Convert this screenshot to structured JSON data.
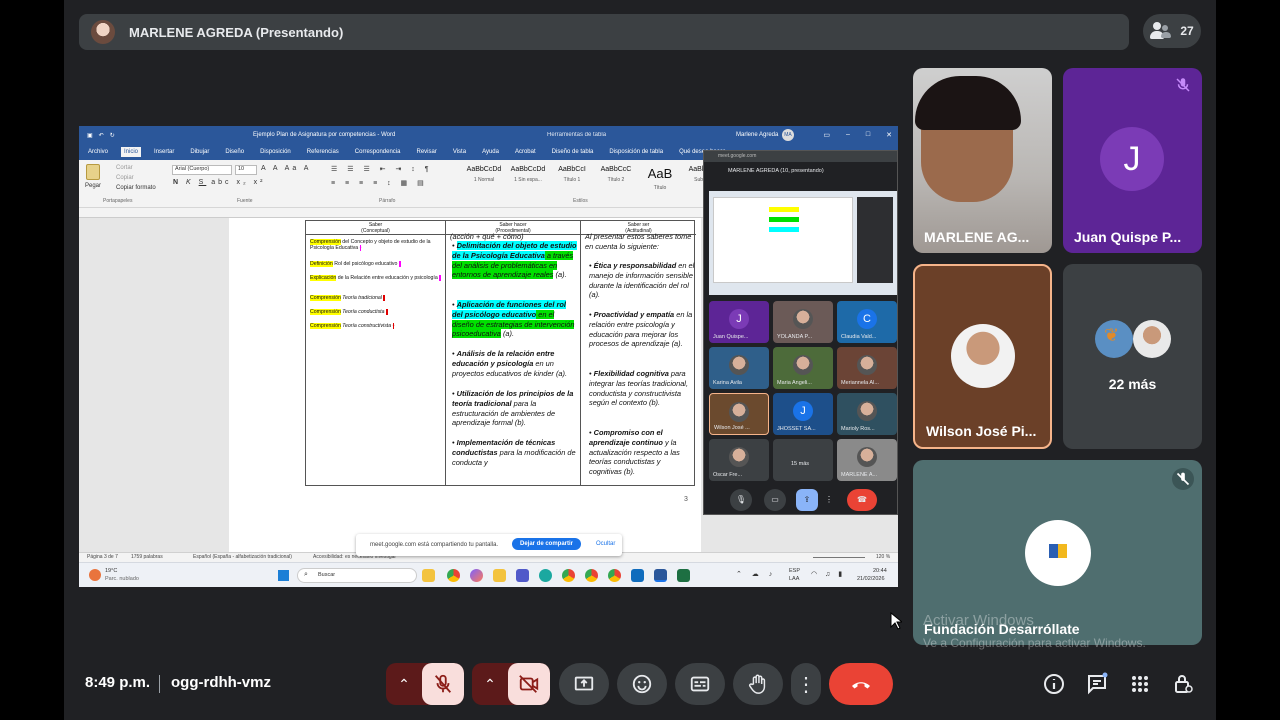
{
  "presenter_bar": {
    "name": "MARLENE AGREDA (Presentando)",
    "participant_count": "27"
  },
  "word": {
    "title": "Ejemplo Plan de Asignatura por competencias - Word",
    "tools_title": "Herramientas de tabla",
    "user": "Marlene Agreda",
    "user_initials": "MA",
    "tabs": [
      "Archivo",
      "Inicio",
      "Insertar",
      "Dibujar",
      "Diseño",
      "Disposición",
      "Referencias",
      "Correspondencia",
      "Revisar",
      "Vista",
      "Ayuda",
      "Acrobat",
      "Diseño de tabla",
      "Disposición de tabla",
      "Qué desea hacer"
    ],
    "clipboard": {
      "paste": "Pegar",
      "cut": "Cortar",
      "copy": "Copiar",
      "format": "Copiar formato",
      "group": "Portapapeles"
    },
    "font": {
      "name": "Arial (Cuerpo)",
      "size": "10",
      "group": "Fuente"
    },
    "paragraph_group": "Párrafo",
    "styles_group": "Estilos",
    "styles": [
      {
        "sample": "AaBbCcDd",
        "name": "1 Normal"
      },
      {
        "sample": "AaBbCcDd",
        "name": "1 Sin espa..."
      },
      {
        "sample": "AaBbCcI",
        "name": "Título 1"
      },
      {
        "sample": "AaBbCcC",
        "name": "Título 2"
      },
      {
        "sample": "AaB",
        "name": "Título"
      },
      {
        "sample": "AaBbCcD",
        "name": "Subtítulo"
      }
    ],
    "table_headers": [
      {
        "a": "Saber",
        "b": "(Conceptual)"
      },
      {
        "a": "Saber hacer",
        "b": "(Procedimental)"
      },
      {
        "a": "Saber ser",
        "b": "(Actitudinal)"
      }
    ],
    "col1": [
      {
        "hl": "Comprensión",
        "text": " del Concepto y objeto de estudio de la Psicología Educativa"
      },
      {
        "hl": "Definición",
        "text": " Rol del psicólogo educativo"
      },
      {
        "hl": "Explicación",
        "text": " de la Relación entre educación y psicología"
      },
      {
        "hl": "Comprensión",
        "text": " Teoría tradicional"
      },
      {
        "hl": "Comprensión",
        "text": " Teoría conductista"
      },
      {
        "hl": "Comprensión",
        "text": " Teoría constructivista"
      }
    ],
    "col2_top": "(acción + qué + cómo)",
    "col2_items": [
      {
        "b1": "Delimitación",
        "b2": " del objeto de estudio de la Psicología Educativa",
        "r": " a través del análisis de problemáticas en entornos de aprendizaje reales",
        "s": " (a)."
      },
      {
        "b1": "Aplicación",
        "b2": " de funciones del rol del psicólogo educativo",
        "r": " en el diseño de estrategias de intervención psicoeducativa",
        "s": " (a)."
      },
      {
        "b1": "Análisis de la relación",
        "b2": " entre educación y psicología",
        "r": " en un proyectos educativos de kinder (a).",
        "s": ""
      },
      {
        "b1": "Utilización de los principios",
        "b2": " de la teoría tradicional",
        "r": " para la estructuración de ambientes de aprendizaje formal (b).",
        "s": ""
      },
      {
        "b1": "Implementación de técnicas",
        "b2": " conductistas",
        "r": " para la modificación de conducta y",
        "s": ""
      }
    ],
    "col3_intro": "Al presentar estos saberes tome en cuenta lo siguiente:",
    "col3_items": [
      {
        "b": "Ética y responsabilidad",
        "t": " en el manejo de información sensible durante la identificación del rol (a)."
      },
      {
        "b": "Proactividad y empatía",
        "t": " en la relación entre psicología y educación para mejorar los procesos de aprendizaje (a)."
      },
      {
        "b": "Flexibilidad cognitiva",
        "t": " para integrar las teorías tradicional, conductista y constructivista según el contexto (b)."
      },
      {
        "b": "Compromiso con el aprendizaje continuo",
        "t": " y la actualización respecto a las teorías conductistas y cognitivas (b)."
      }
    ],
    "page_number": "3",
    "status": {
      "page": "Página 3 de 7",
      "words": "1759 palabras",
      "lang": "Español (España - alfabetización tradicional)",
      "acc": "Accesibilidad: es necesario investigar",
      "zoom": "120 %"
    },
    "share_notice": {
      "text": "meet.google.com está compartiendo tu pantalla.",
      "stop": "Dejar de compartir",
      "hide": "Ocultar"
    }
  },
  "windows_taskbar": {
    "weather_temp": "19°C",
    "weather_desc": "Parc. nublado",
    "search": "Buscar",
    "lang_1": "ESP",
    "lang_2": "LAA",
    "time": "20:44",
    "date": "21/02/2026"
  },
  "mini_meet": {
    "url": "meet.google.com",
    "title": "MARLENE AGREDA (10, presentando)",
    "tiles": [
      {
        "label": "Juan Quispe...",
        "initial": "J",
        "color": "#5d2596"
      },
      {
        "label": "YOLANDA P...",
        "initial": "",
        "color": "#6b5a57"
      },
      {
        "label": "Claudia Vald...",
        "initial": "C",
        "color": "#1e6aa8"
      },
      {
        "label": "Karina Avila",
        "initial": "",
        "color": "#2f5f8a"
      },
      {
        "label": "Maria Angeli...",
        "initial": "",
        "color": "#4d6b3a"
      },
      {
        "label": "Meriannela Al...",
        "initial": "",
        "color": "#6b4436"
      },
      {
        "label": "Wilson José ...",
        "initial": "",
        "color": "#6b4a2e"
      },
      {
        "label": "JHOSSET SA...",
        "initial": "J",
        "color": "#1d4f8a"
      },
      {
        "label": "Marioly Ros...",
        "initial": "",
        "color": "#2f5060"
      },
      {
        "label": "Oscar Fre...",
        "initial": "",
        "color": "#3c4043"
      },
      {
        "label": "15 más",
        "initial": "",
        "color": "#3c4043"
      },
      {
        "label": "MARLENE A...",
        "initial": "",
        "color": "#8a8a8a"
      }
    ]
  },
  "participants": {
    "marlene": "MARLENE AG...",
    "juan": "Juan Quispe P...",
    "juan_initial": "J",
    "wilson": "Wilson José Pi...",
    "more": "22 más",
    "fundacion": "Fundación Desarróllate"
  },
  "watermark": {
    "line1": "Activar Windows",
    "line2": "Ve a Configuración para activar Windows."
  },
  "toolbar": {
    "time": "8:49 p.m.",
    "meeting_code": "ogg-rdhh-vmz"
  },
  "colors": {
    "end_call": "#ea4335",
    "accent": "#1a73e8",
    "active_mute": "#f9dedc"
  }
}
